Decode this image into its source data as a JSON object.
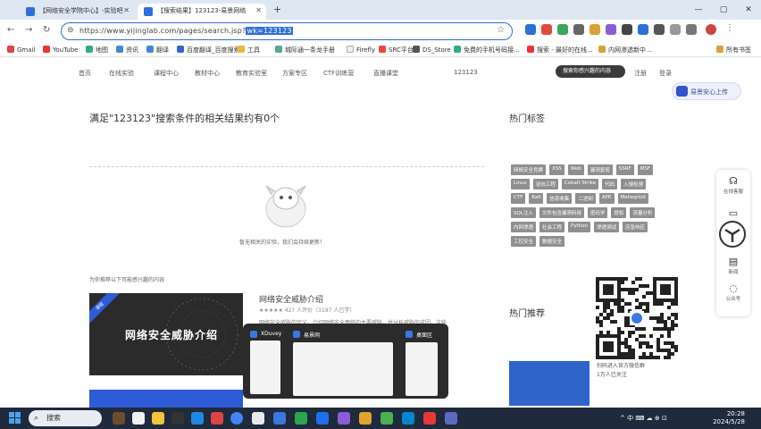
{
  "browser": {
    "tabs": [
      {
        "title": "【网络安全学院中心】-实验吧",
        "active": false
      },
      {
        "title": "【搜索结果】123123-易景网络",
        "active": true
      }
    ],
    "new_tab": "+",
    "window_controls": [
      "—",
      "▢",
      "✕"
    ],
    "url_prefix": "https://www.yijinglab.com/pages/search.jsp?",
    "url_selected": "wk=123123",
    "bookmarks": [
      "Gmail",
      "YouTube",
      "地图",
      "资讯",
      "翻译",
      "百度翻译_百度搜索",
      "工具",
      "城际通一条龙手册",
      "Firefly",
      "SRC平台",
      "DS_Store",
      "免费的手机号码接...",
      "搜索 - 最好的在线...",
      "内网渗透新中...",
      "所有书签"
    ]
  },
  "site_nav": {
    "items": [
      "首页",
      "在线实验",
      "课程中心",
      "教材中心",
      "教育实验室",
      "方案专区",
      "CTF训练营",
      "直播课堂",
      "123123"
    ],
    "search_label": "搜索你感兴趣的内容",
    "register": "注册",
    "login": "登录",
    "upload_button": "易景安心上传"
  },
  "main": {
    "result_title": "满足\"123123\"搜索条件的相关结果约有0个",
    "empty_text": "暂无相关的实验，我们会持续更新！",
    "recommend_title": "为你推荐以下可能感兴趣的内容",
    "card_ribbon": "课程",
    "card_title": "网络安全威胁介绍",
    "course_title": "网络安全威胁介绍",
    "course_rating": "★★★★★ 427 人评价（3197 人已学）",
    "course_desc": "网络安全威胁的定义，介绍网络安全面临的主要威胁，并分析威胁的成因。这些"
  },
  "right": {
    "hot_tags_title": "热门标签",
    "tags": [
      "网络安全竞赛",
      "XSS",
      "Web",
      "漏洞复现",
      "SSRF",
      "MSF",
      "Linux",
      "逆向工程",
      "Cobalt Strike",
      "代码",
      "入侵检测",
      "CTF",
      "Kali",
      "信息收集",
      "二进制",
      "APK",
      "Metasploit",
      "SQL注入",
      "文件包含漏洞利用",
      "密码学",
      "提权",
      "流量分析",
      "内网渗透",
      "社会工程",
      "Python",
      "渗透测试",
      "应急响应",
      "工控安全",
      "数据安全"
    ],
    "hot_rec_title": "热门推荐",
    "qr_caption_1": "扫码进入官方微信群",
    "qr_caption_2": "1万人已关注"
  },
  "floating_sidebar": {
    "items": [
      "在线客服",
      "新闻",
      "公众号"
    ]
  },
  "task_view": {
    "windows": [
      "XDuvey",
      "易景网",
      "桌面区"
    ]
  },
  "taskbar": {
    "search": "搜索",
    "tray": "^ 中 ⌨ ☁ ⊕ ⊡",
    "time": "20:28",
    "date": "2024/5/28"
  },
  "colors": {
    "accent": "#2e6fd8",
    "tag_bg": "#8f8f8f",
    "taskbar": "#1f2a3c",
    "card_dark": "#2b2b2b"
  }
}
